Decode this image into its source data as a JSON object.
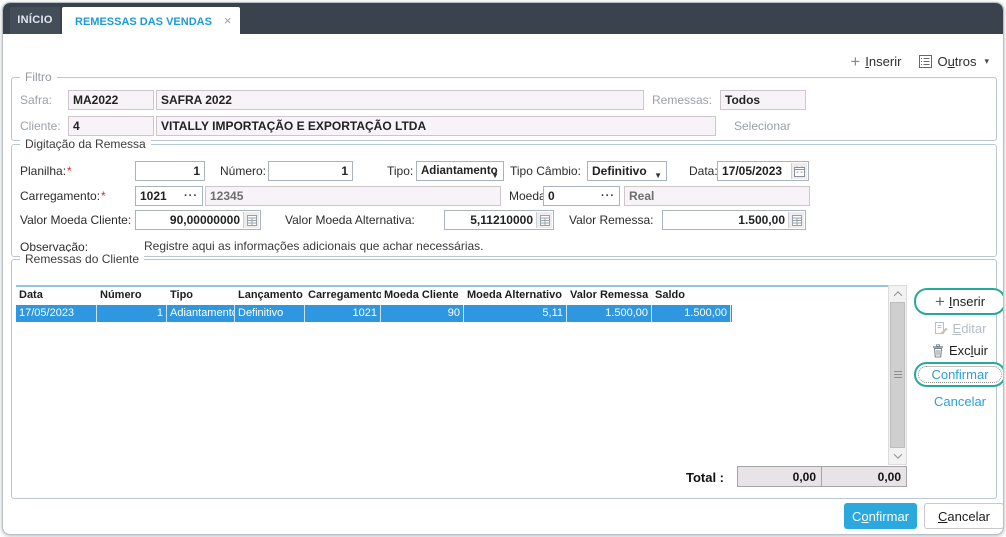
{
  "tabs": {
    "inicio": "INÍCIO",
    "active": "REMESSAS DAS VENDAS"
  },
  "icons": {
    "close": "×",
    "plus": "+",
    "dropdown": "▼",
    "menu_chevron": "▾",
    "lookup": "···"
  },
  "toolbar": {
    "inserir": {
      "accel": "I",
      "rest": "nserir"
    },
    "outros": {
      "pre": "O",
      "accel": "u",
      "rest": "tros"
    }
  },
  "filtro": {
    "legend": "Filtro",
    "safra_label": "Safra:",
    "safra_code": "MA2022",
    "safra_desc": "SAFRA 2022",
    "remessas_label": "Remessas:",
    "remessas_value": "Todos",
    "cliente_label": "Cliente:",
    "cliente_code": "4",
    "cliente_desc": "VITALLY IMPORTAÇÃO E EXPORTAÇÃO LTDA",
    "selecionar": "Selecionar"
  },
  "digitacao": {
    "legend": "Digitação da Remessa",
    "required_mark": "*",
    "planilha_label": "Planilha:",
    "planilha_value": "1",
    "numero_label": "Número:",
    "numero_value": "1",
    "tipo_label": "Tipo:",
    "tipo_value": "Adiantamento",
    "tipo_cambio_label": "Tipo Câmbio:",
    "tipo_cambio_value": "Definitivo",
    "data_label": "Data:",
    "data_value": "17/05/2023",
    "carregamento_label": "Carregamento:",
    "carregamento_code": "1021",
    "carregamento_desc": "12345",
    "moeda_label": "Moeda:",
    "moeda_code": "0",
    "moeda_desc": "Real",
    "valor_moeda_cliente_label": "Valor Moeda Cliente:",
    "valor_moeda_cliente_value": "90,00000000",
    "valor_moeda_alt_label": "Valor Moeda Alternativa:",
    "valor_moeda_alt_value": "5,11210000",
    "valor_remessa_label": "Valor Remessa:",
    "valor_remessa_value": "1.500,00",
    "observacao_label": "Observação:",
    "observacao_text": "Registre aqui as informações adicionais que achar necessárias."
  },
  "remessas": {
    "legend": "Remessas do Cliente",
    "columns": [
      "Data",
      "Número",
      "Tipo",
      "Lançamento",
      "Carregamento",
      "Moeda Cliente",
      "Moeda Alternativo",
      "Valor Remessa",
      "Saldo"
    ],
    "row": {
      "data": "17/05/2023",
      "numero": "1",
      "tipo": "Adiantamento",
      "lancamento": "Definitivo",
      "carregamento": "1021",
      "moeda_cliente": "90",
      "moeda_alternativo": "5,11",
      "valor_remessa": "1.500,00",
      "saldo": "1.500,00"
    },
    "total_label": "Total :",
    "total_moeda": "0,00",
    "total_saldo": "0,00",
    "buttons": {
      "inserir": {
        "accel": "I",
        "rest": "nserir"
      },
      "editar": {
        "accel": "E",
        "rest": "ditar"
      },
      "excluir": {
        "pre": "Exc",
        "accel": "l",
        "rest": "uir"
      },
      "confirmar": "Confirmar",
      "cancelar": "Cancelar"
    }
  },
  "footer": {
    "confirmar": {
      "pre": "C",
      "accel": "o",
      "rest": "nfirmar"
    },
    "cancelar": {
      "accel": "C",
      "rest": "ancelar"
    }
  },
  "colors": {
    "tab_bar": "#39424d",
    "tab_active_text": "#1e9ad6",
    "selected_row": "#2f97e0",
    "button_outline": "#2aa79b",
    "link_blue": "#2b9fd8",
    "primary_button": "#2ba9de",
    "required": "#cf2b2b",
    "disabled_field": "#f8f3f8"
  }
}
